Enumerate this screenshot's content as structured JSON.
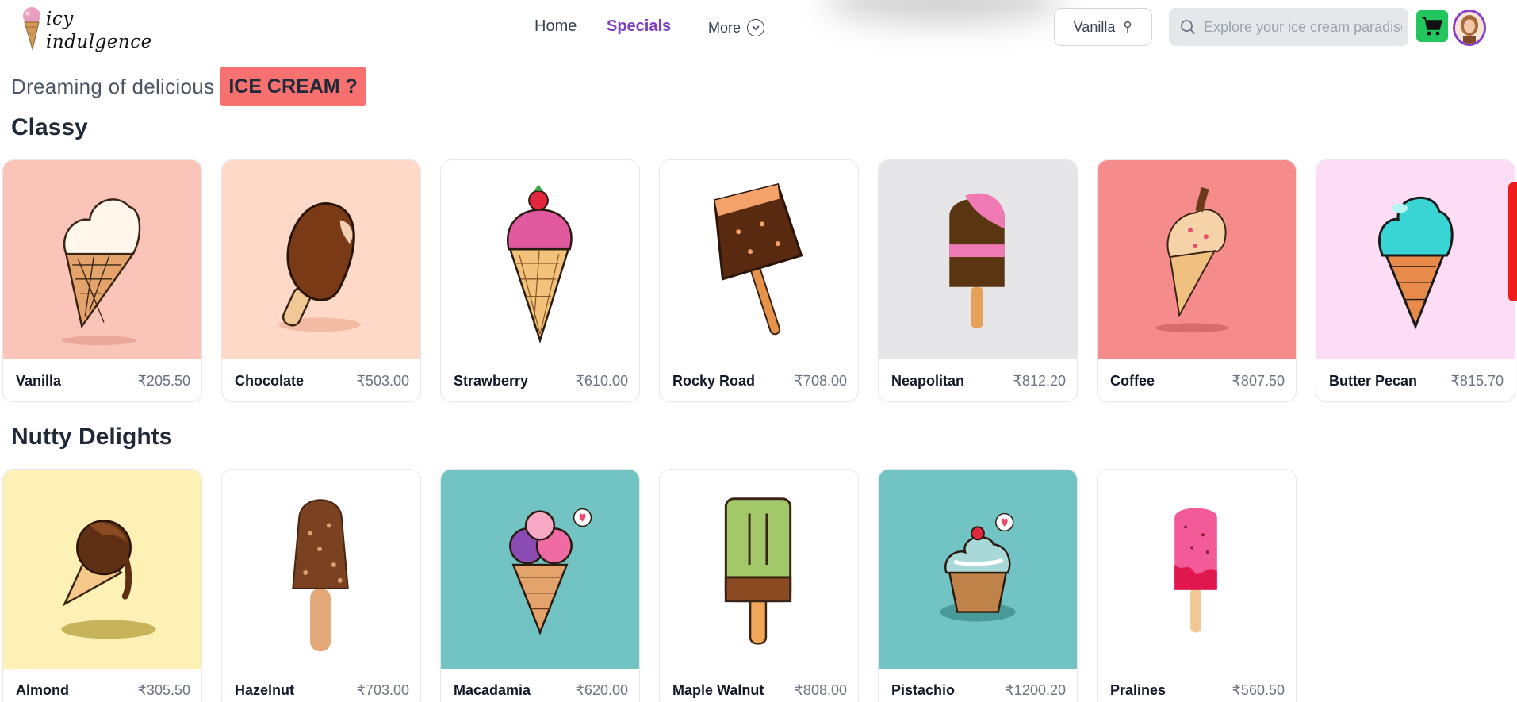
{
  "header": {
    "logo_line1": "icy",
    "logo_line2": "indulgence",
    "nav": [
      {
        "label": "Home"
      },
      {
        "label": "Specials"
      },
      {
        "label": "More"
      }
    ],
    "flavor_select": {
      "selected": "Vanilla"
    },
    "search": {
      "placeholder": "Explore your ice cream paradise"
    },
    "colors": {
      "accent": "#7e3ec2",
      "cart": "#22c55e",
      "badge": "#f87171"
    }
  },
  "tagline": {
    "text": "Dreaming of delicious",
    "badge": "ICE CREAM ?"
  },
  "sections": [
    {
      "title": "Classy",
      "items": [
        {
          "name": "Vanilla",
          "price": "₹205.50",
          "bg": "#fbc4b8",
          "icon": "vanilla-cone-icon"
        },
        {
          "name": "Chocolate",
          "price": "₹503.00",
          "bg": "#ffd9c8",
          "icon": "chocolate-bar-icon"
        },
        {
          "name": "Strawberry",
          "price": "₹610.00",
          "bg": "#ffffff",
          "icon": "strawberry-cone-icon"
        },
        {
          "name": "Rocky Road",
          "price": "₹708.00",
          "bg": "#ffffff",
          "icon": "rocky-road-bar-icon"
        },
        {
          "name": "Neapolitan",
          "price": "₹812.20",
          "bg": "#e6e6e8",
          "icon": "neapolitan-popsicle-icon"
        },
        {
          "name": "Coffee",
          "price": "₹807.50",
          "bg": "#f68b8c",
          "icon": "coffee-cone-icon"
        },
        {
          "name": "Butter Pecan",
          "price": "₹815.70",
          "bg": "#fdddf6",
          "icon": "mint-cone-icon"
        }
      ]
    },
    {
      "title": "Nutty Delights",
      "items": [
        {
          "name": "Almond",
          "price": "₹305.50",
          "bg": "#fdf1b5",
          "icon": "almond-cone-icon"
        },
        {
          "name": "Hazelnut",
          "price": "₹703.00",
          "bg": "#ffffff",
          "icon": "hazelnut-bar-icon"
        },
        {
          "name": "Macadamia",
          "price": "₹620.00",
          "bg": "#72c4c4",
          "icon": "macadamia-cone-icon"
        },
        {
          "name": "Maple Walnut",
          "price": "₹808.00",
          "bg": "#ffffff",
          "icon": "maple-popsicle-icon"
        },
        {
          "name": "Pistachio",
          "price": "₹1200.20",
          "bg": "#72c4c4",
          "icon": "pistachio-cupcake-icon"
        },
        {
          "name": "Pralines",
          "price": "₹560.50",
          "bg": "#ffffff",
          "icon": "pralines-popsicle-icon"
        }
      ]
    }
  ]
}
